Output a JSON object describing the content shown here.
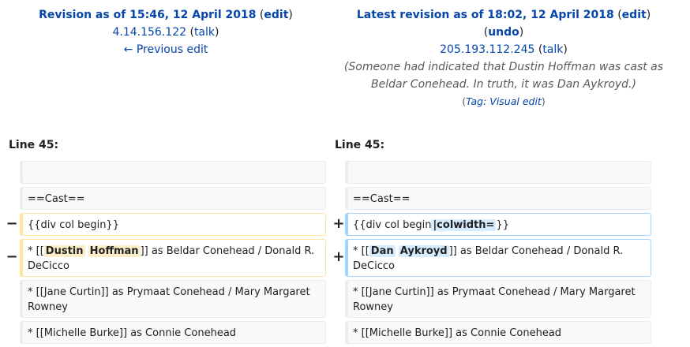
{
  "left_header": {
    "title_prefix": "Revision as of 15:46, 12 April 2018",
    "edit_link": "edit",
    "user": "4.14.156.122",
    "talk": "talk",
    "prev_edit": "← Previous edit"
  },
  "right_header": {
    "title_prefix": "Latest revision as of 18:02, 12 April 2018",
    "edit_link": "edit",
    "undo_link": "undo",
    "user": "205.193.112.245",
    "talk": "talk",
    "summary_line1": "(Someone had indicated that Dustin Hoffman was cast as",
    "summary_line2": "Beldar Conehead. In truth, it was Dan Aykroyd.)",
    "tag_label": "Tag",
    "tag_value": "Visual edit"
  },
  "line_numbers": {
    "left": "Line 45:",
    "right": "Line 45:"
  },
  "markers": {
    "minus": "−",
    "plus": "+"
  },
  "diff": {
    "left": {
      "row1": "",
      "row2": "==Cast==",
      "row3": "{{div col begin}}",
      "row4_pre": "* [[",
      "row4_hl1": "Dustin",
      "row4_hl2": "Hoffman",
      "row4_post": "]] as Beldar Conehead / Donald R. DeCicco",
      "row5": "* [[Jane Curtin]] as Prymaat Conehead / Mary Margaret Rowney",
      "row6": "* [[Michelle Burke]] as Connie Conehead"
    },
    "right": {
      "row1": "",
      "row2": "==Cast==",
      "row3_pre": "{{div col begin",
      "row3_hl": "|colwidth=",
      "row3_post": "}}",
      "row4_pre": "* [[",
      "row4_hl1": "Dan",
      "row4_hl2": "Aykroyd",
      "row4_post": "]] as Beldar Conehead / Donald R. DeCicco",
      "row5": "* [[Jane Curtin]] as Prymaat Conehead / Mary Margaret Rowney",
      "row6": "* [[Michelle Burke]] as Connie Conehead"
    }
  },
  "colors": {
    "link": "#0645ad",
    "deleted_border": "#ffe49c",
    "deleted_highlight": "#feeec8",
    "added_border": "#a3d3ff",
    "added_highlight": "#d8ecff",
    "context_bg": "#f8f9fa"
  }
}
